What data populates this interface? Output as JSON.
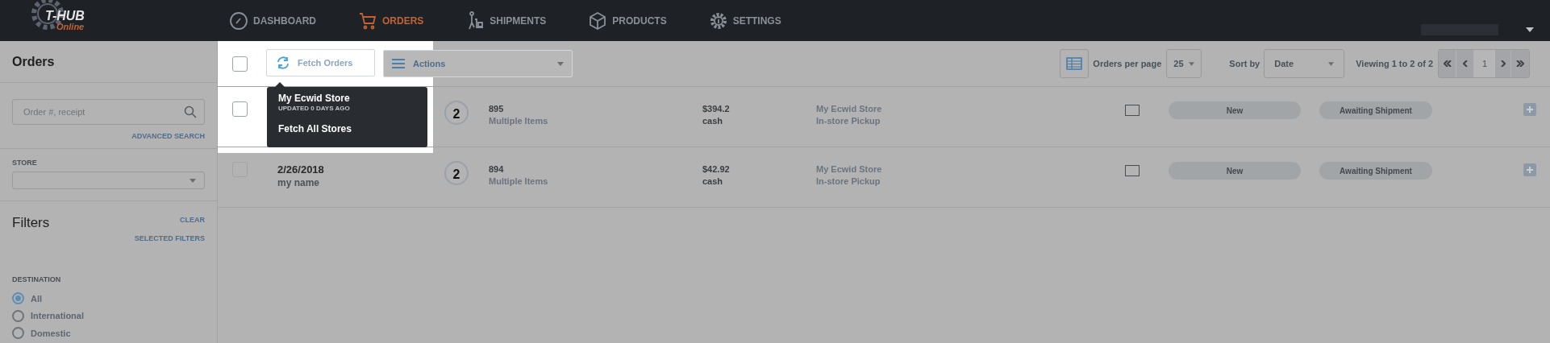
{
  "nav": {
    "logo": {
      "title": "T-HUB",
      "subtitle": "Online"
    },
    "items": [
      {
        "label": "DASHBOARD",
        "kind": "gauge",
        "selected": false
      },
      {
        "label": "ORDERS",
        "kind": "cart",
        "selected": true
      },
      {
        "label": "SHIPMENTS",
        "kind": "dolly",
        "selected": false
      },
      {
        "label": "PRODUCTS",
        "kind": "box",
        "selected": false
      },
      {
        "label": "SETTINGS",
        "kind": "gear",
        "selected": false
      }
    ]
  },
  "sidebar": {
    "title": "Orders",
    "search": {
      "placeholder": "Order #, receipt"
    },
    "advanced_search": "ADVANCED SEARCH",
    "store_label": "STORE",
    "filters_title": "Filters",
    "clear": "CLEAR",
    "selected_filters": "SELECTED FILTERS",
    "destination_label": "DESTINATION",
    "destinations": [
      {
        "label": "All",
        "selected": true
      },
      {
        "label": "International",
        "selected": false
      },
      {
        "label": "Domestic",
        "selected": false
      }
    ]
  },
  "toolbar": {
    "select_all_checked": false,
    "fetch_button": "Fetch Orders",
    "actions": "Actions",
    "per_page_label": "Orders per page",
    "per_page": "25",
    "sort_label": "Sort by",
    "sort": "Date",
    "viewing": "Viewing 1 to 2 of 2",
    "page": "1"
  },
  "tooltip": {
    "store": "My Ecwid Store",
    "updated": "UPDATED 0 DAYS AGO",
    "fetch_all": "Fetch All Stores"
  },
  "orders": [
    {
      "checked": false,
      "count": "2",
      "number": "895",
      "items": "Multiple Items",
      "total": "$394.2",
      "payment": "cash",
      "store": "My Ecwid Store",
      "shipping": "In-store Pickup",
      "flagged": false,
      "status": "New",
      "shipment": "Awaiting Shipment"
    },
    {
      "checked": false,
      "date": "2/26/2018",
      "name": "my name",
      "count": "2",
      "number": "894",
      "items": "Multiple Items",
      "total": "$42.92",
      "payment": "cash",
      "store": "My Ecwid Store",
      "shipping": "In-store Pickup",
      "flagged": false,
      "status": "New",
      "shipment": "Awaiting Shipment"
    }
  ]
}
